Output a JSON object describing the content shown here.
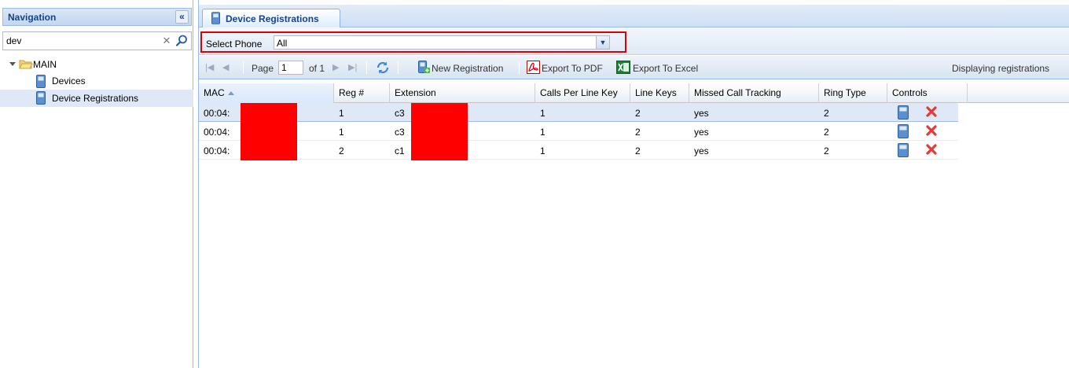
{
  "navigation": {
    "title": "Navigation",
    "collapse_icon": "double-chevron-left-icon",
    "search": {
      "value": "dev",
      "placeholder": ""
    },
    "tree": {
      "root_label": "MAIN",
      "items": [
        {
          "label": "Devices",
          "icon": "phone-icon",
          "selected": false
        },
        {
          "label": "Device Registrations",
          "icon": "phone-icon",
          "selected": true
        }
      ]
    }
  },
  "tabs": [
    {
      "label": "Device Registrations",
      "icon": "phone-icon",
      "active": true
    }
  ],
  "filter": {
    "label": "Select Phone",
    "selected": "All",
    "highlight_color": "#e00000"
  },
  "toolbar": {
    "page_label": "Page",
    "page_value": "1",
    "of_label": "of 1",
    "new_label": "New Registration",
    "pdf_label": "Export To PDF",
    "excel_label": "Export To Excel",
    "display_text": "Displaying registrations"
  },
  "grid": {
    "columns": [
      "MAC",
      "Reg #",
      "Extension",
      "Calls Per Line Key",
      "Line Keys",
      "Missed Call Tracking",
      "Ring Type",
      "Controls"
    ],
    "sorted_column": "MAC",
    "rows": [
      {
        "mac": "00:04:",
        "reg": "1",
        "ext": "c3",
        "calls": "1",
        "keys": "2",
        "missed": "yes",
        "ring": "2"
      },
      {
        "mac": "00:04:",
        "reg": "1",
        "ext": "c3",
        "calls": "1",
        "keys": "2",
        "missed": "yes",
        "ring": "2"
      },
      {
        "mac": "00:04:",
        "reg": "2",
        "ext": "c1",
        "calls": "1",
        "keys": "2",
        "missed": "yes",
        "ring": "2"
      }
    ]
  },
  "colors": {
    "header_blue": "#15428b",
    "border_blue": "#99bbe8",
    "selection": "#dfe8f6",
    "redaction": "#ff0000"
  }
}
